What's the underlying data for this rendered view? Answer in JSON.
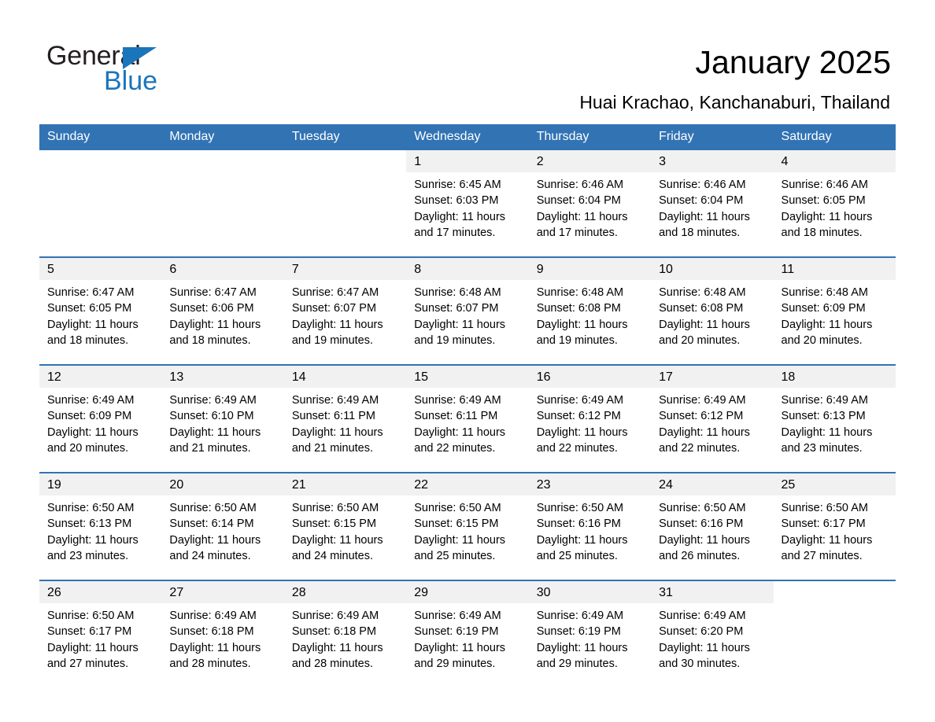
{
  "brand": {
    "name_part1": "General",
    "name_part2": "Blue",
    "triangle_color": "#1b75bb",
    "accent_color": "#3273b4"
  },
  "header": {
    "title": "January 2025",
    "subtitle": "Huai Krachao, Kanchanaburi, Thailand"
  },
  "calendar": {
    "weekday_headers": [
      "Sunday",
      "Monday",
      "Tuesday",
      "Wednesday",
      "Thursday",
      "Friday",
      "Saturday"
    ],
    "weeks": [
      [
        {
          "day": "",
          "blank": true
        },
        {
          "day": "",
          "blank": true
        },
        {
          "day": "",
          "blank": true
        },
        {
          "day": "1",
          "sunrise": "Sunrise: 6:45 AM",
          "sunset": "Sunset: 6:03 PM",
          "daylight_line1": "Daylight: 11 hours",
          "daylight_line2": "and 17 minutes."
        },
        {
          "day": "2",
          "sunrise": "Sunrise: 6:46 AM",
          "sunset": "Sunset: 6:04 PM",
          "daylight_line1": "Daylight: 11 hours",
          "daylight_line2": "and 17 minutes."
        },
        {
          "day": "3",
          "sunrise": "Sunrise: 6:46 AM",
          "sunset": "Sunset: 6:04 PM",
          "daylight_line1": "Daylight: 11 hours",
          "daylight_line2": "and 18 minutes."
        },
        {
          "day": "4",
          "sunrise": "Sunrise: 6:46 AM",
          "sunset": "Sunset: 6:05 PM",
          "daylight_line1": "Daylight: 11 hours",
          "daylight_line2": "and 18 minutes."
        }
      ],
      [
        {
          "day": "5",
          "sunrise": "Sunrise: 6:47 AM",
          "sunset": "Sunset: 6:05 PM",
          "daylight_line1": "Daylight: 11 hours",
          "daylight_line2": "and 18 minutes."
        },
        {
          "day": "6",
          "sunrise": "Sunrise: 6:47 AM",
          "sunset": "Sunset: 6:06 PM",
          "daylight_line1": "Daylight: 11 hours",
          "daylight_line2": "and 18 minutes."
        },
        {
          "day": "7",
          "sunrise": "Sunrise: 6:47 AM",
          "sunset": "Sunset: 6:07 PM",
          "daylight_line1": "Daylight: 11 hours",
          "daylight_line2": "and 19 minutes."
        },
        {
          "day": "8",
          "sunrise": "Sunrise: 6:48 AM",
          "sunset": "Sunset: 6:07 PM",
          "daylight_line1": "Daylight: 11 hours",
          "daylight_line2": "and 19 minutes."
        },
        {
          "day": "9",
          "sunrise": "Sunrise: 6:48 AM",
          "sunset": "Sunset: 6:08 PM",
          "daylight_line1": "Daylight: 11 hours",
          "daylight_line2": "and 19 minutes."
        },
        {
          "day": "10",
          "sunrise": "Sunrise: 6:48 AM",
          "sunset": "Sunset: 6:08 PM",
          "daylight_line1": "Daylight: 11 hours",
          "daylight_line2": "and 20 minutes."
        },
        {
          "day": "11",
          "sunrise": "Sunrise: 6:48 AM",
          "sunset": "Sunset: 6:09 PM",
          "daylight_line1": "Daylight: 11 hours",
          "daylight_line2": "and 20 minutes."
        }
      ],
      [
        {
          "day": "12",
          "sunrise": "Sunrise: 6:49 AM",
          "sunset": "Sunset: 6:09 PM",
          "daylight_line1": "Daylight: 11 hours",
          "daylight_line2": "and 20 minutes."
        },
        {
          "day": "13",
          "sunrise": "Sunrise: 6:49 AM",
          "sunset": "Sunset: 6:10 PM",
          "daylight_line1": "Daylight: 11 hours",
          "daylight_line2": "and 21 minutes."
        },
        {
          "day": "14",
          "sunrise": "Sunrise: 6:49 AM",
          "sunset": "Sunset: 6:11 PM",
          "daylight_line1": "Daylight: 11 hours",
          "daylight_line2": "and 21 minutes."
        },
        {
          "day": "15",
          "sunrise": "Sunrise: 6:49 AM",
          "sunset": "Sunset: 6:11 PM",
          "daylight_line1": "Daylight: 11 hours",
          "daylight_line2": "and 22 minutes."
        },
        {
          "day": "16",
          "sunrise": "Sunrise: 6:49 AM",
          "sunset": "Sunset: 6:12 PM",
          "daylight_line1": "Daylight: 11 hours",
          "daylight_line2": "and 22 minutes."
        },
        {
          "day": "17",
          "sunrise": "Sunrise: 6:49 AM",
          "sunset": "Sunset: 6:12 PM",
          "daylight_line1": "Daylight: 11 hours",
          "daylight_line2": "and 22 minutes."
        },
        {
          "day": "18",
          "sunrise": "Sunrise: 6:49 AM",
          "sunset": "Sunset: 6:13 PM",
          "daylight_line1": "Daylight: 11 hours",
          "daylight_line2": "and 23 minutes."
        }
      ],
      [
        {
          "day": "19",
          "sunrise": "Sunrise: 6:50 AM",
          "sunset": "Sunset: 6:13 PM",
          "daylight_line1": "Daylight: 11 hours",
          "daylight_line2": "and 23 minutes."
        },
        {
          "day": "20",
          "sunrise": "Sunrise: 6:50 AM",
          "sunset": "Sunset: 6:14 PM",
          "daylight_line1": "Daylight: 11 hours",
          "daylight_line2": "and 24 minutes."
        },
        {
          "day": "21",
          "sunrise": "Sunrise: 6:50 AM",
          "sunset": "Sunset: 6:15 PM",
          "daylight_line1": "Daylight: 11 hours",
          "daylight_line2": "and 24 minutes."
        },
        {
          "day": "22",
          "sunrise": "Sunrise: 6:50 AM",
          "sunset": "Sunset: 6:15 PM",
          "daylight_line1": "Daylight: 11 hours",
          "daylight_line2": "and 25 minutes."
        },
        {
          "day": "23",
          "sunrise": "Sunrise: 6:50 AM",
          "sunset": "Sunset: 6:16 PM",
          "daylight_line1": "Daylight: 11 hours",
          "daylight_line2": "and 25 minutes."
        },
        {
          "day": "24",
          "sunrise": "Sunrise: 6:50 AM",
          "sunset": "Sunset: 6:16 PM",
          "daylight_line1": "Daylight: 11 hours",
          "daylight_line2": "and 26 minutes."
        },
        {
          "day": "25",
          "sunrise": "Sunrise: 6:50 AM",
          "sunset": "Sunset: 6:17 PM",
          "daylight_line1": "Daylight: 11 hours",
          "daylight_line2": "and 27 minutes."
        }
      ],
      [
        {
          "day": "26",
          "sunrise": "Sunrise: 6:50 AM",
          "sunset": "Sunset: 6:17 PM",
          "daylight_line1": "Daylight: 11 hours",
          "daylight_line2": "and 27 minutes."
        },
        {
          "day": "27",
          "sunrise": "Sunrise: 6:49 AM",
          "sunset": "Sunset: 6:18 PM",
          "daylight_line1": "Daylight: 11 hours",
          "daylight_line2": "and 28 minutes."
        },
        {
          "day": "28",
          "sunrise": "Sunrise: 6:49 AM",
          "sunset": "Sunset: 6:18 PM",
          "daylight_line1": "Daylight: 11 hours",
          "daylight_line2": "and 28 minutes."
        },
        {
          "day": "29",
          "sunrise": "Sunrise: 6:49 AM",
          "sunset": "Sunset: 6:19 PM",
          "daylight_line1": "Daylight: 11 hours",
          "daylight_line2": "and 29 minutes."
        },
        {
          "day": "30",
          "sunrise": "Sunrise: 6:49 AM",
          "sunset": "Sunset: 6:19 PM",
          "daylight_line1": "Daylight: 11 hours",
          "daylight_line2": "and 29 minutes."
        },
        {
          "day": "31",
          "sunrise": "Sunrise: 6:49 AM",
          "sunset": "Sunset: 6:20 PM",
          "daylight_line1": "Daylight: 11 hours",
          "daylight_line2": "and 30 minutes."
        },
        {
          "day": "",
          "blank": true
        }
      ]
    ]
  }
}
